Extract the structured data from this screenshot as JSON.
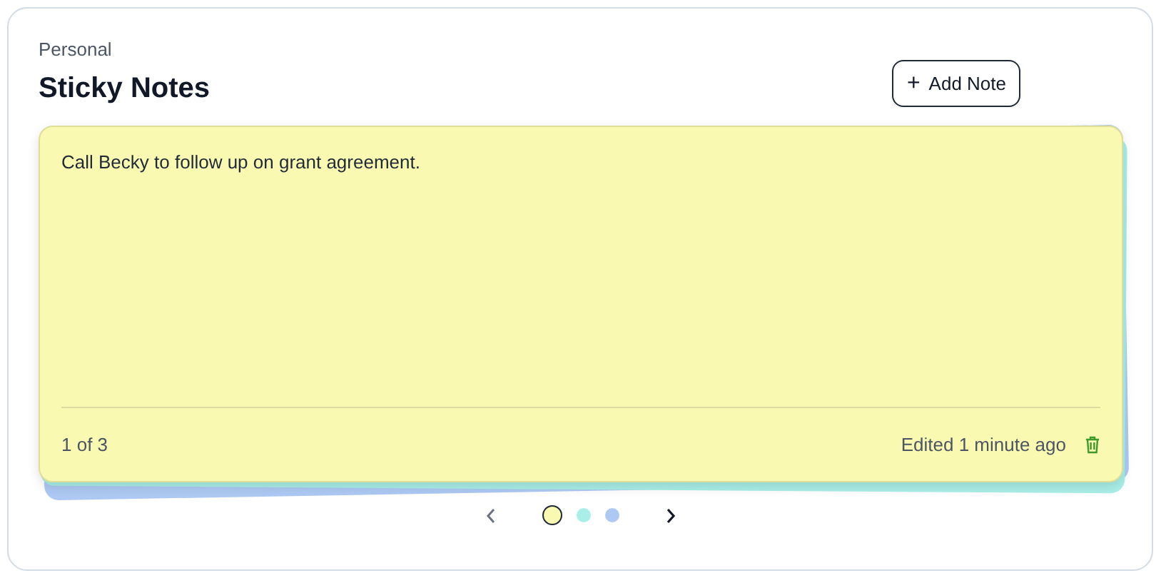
{
  "header": {
    "category": "Personal",
    "title": "Sticky Notes"
  },
  "add_button": {
    "icon": "+",
    "label": "Add Note"
  },
  "notes": [
    {
      "color": "#f9f9b1",
      "selected": true,
      "text": "Call Becky to follow up on grant agreement."
    },
    {
      "color": "#a9efe8",
      "selected": false
    },
    {
      "color": "#adc9f3",
      "selected": false
    }
  ],
  "footer": {
    "counter": "1 of 3",
    "edited": "Edited 1 minute ago"
  }
}
